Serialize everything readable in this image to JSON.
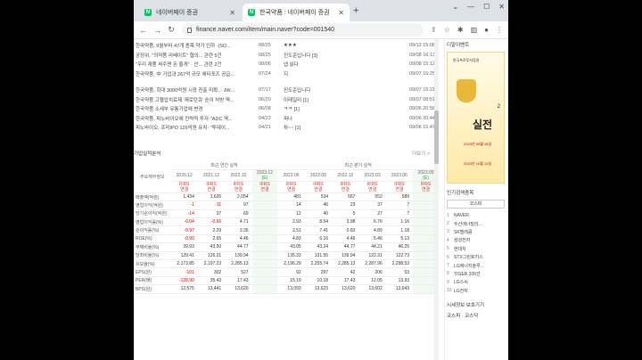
{
  "tabs": [
    {
      "label": "네이버페이 증권"
    },
    {
      "label": "한국약품 : 네이버페이 증권"
    }
  ],
  "address": {
    "url": "finance.naver.com/item/main.naver?code=001540"
  },
  "news": [
    {
      "title": "한국약품, 9월부터 47개 종목 약가 인하 ·(SO...",
      "date": "08/25",
      "comment": "★★★",
      "time": "09/12 15:08"
    },
    {
      "title": "공정위, \"의약품 리베이트\" 협의...  관련 5건",
      "date": "08/25",
      "comment": "진도준입니다 [3]",
      "time": "09/08 16:13"
    },
    {
      "title": "\"우리 제품 써주면 돈 줄게\" · 안...  관련 2건",
      "date": "08/06",
      "comment": "넵 읽다",
      "time": "09/08 15:12"
    },
    {
      "title": "한국약품, 中 기업과 267억 규모 에티포즈 공급...",
      "date": "07/24",
      "comment": "지",
      "time": "09/07 15:25"
    },
    {
      "title": "한국약품, 회대 3000억원 시장 진출 미확..· JW...",
      "date": "07/17",
      "comment": "진도준입니다",
      "time": "09/07 15:21"
    },
    {
      "title": "한국약품 고혈압치료제 '제로탄큐' 승이 처방 역...",
      "date": "06/20",
      "comment": "이레일리 [1]",
      "time": "09/07 08:51"
    },
    {
      "title": "한국약품 소세부 유통기업에 변경",
      "date": "06/08",
      "comment": "ㅋㅋ [1]",
      "time": "09/06 20:58"
    },
    {
      "title": "한국약품, 피노바이오에 전략적 투자·\"ADC 역...",
      "date": "04/22",
      "comment": "퍼나",
      "time": "09/06 20:44"
    },
    {
      "title": "피노바이오, 프리IPO 126억원 유치· \"투데이...",
      "date": "04/21",
      "comment": "차~~ [1]",
      "time": "09/06 15:47"
    }
  ],
  "section": {
    "title": "기업실적분석",
    "more": "더보기 >"
  },
  "table": {
    "group_annual": "최근 연간 실적",
    "group_quarter": "최근 분기 실적",
    "label_header": "주요재무정보",
    "periods": [
      "2020.12",
      "2021.12",
      "2022.12",
      "2023.12",
      "2022.06",
      "2022.09",
      "2022.12",
      "2023.03",
      "2023.06",
      "2023.09"
    ],
    "estimate_tag": "(E)",
    "ifrs_line1": "IFRS",
    "ifrs_line2": "연결",
    "rows": [
      {
        "label": "매출액(억원)",
        "values": [
          "1,434",
          "1,635",
          "2,054",
          "",
          "481",
          "534",
          "567",
          "552",
          "589",
          ""
        ]
      },
      {
        "label": "영업이익(억원)",
        "values": [
          "-1",
          "-11",
          "97",
          "",
          "14",
          "46",
          "23",
          "37",
          "7",
          ""
        ]
      },
      {
        "label": "당기순이익(억원)",
        "values": [
          "-14",
          "37",
          "69",
          "",
          "12",
          "40",
          "5",
          "27",
          "7",
          ""
        ]
      },
      {
        "label": "영업이익률(%)",
        "values": [
          "-0.04",
          "-0.66",
          "4.71",
          "",
          "2.93",
          "8.54",
          "3.98",
          "6.76",
          "1.16",
          ""
        ]
      },
      {
        "label": "순이익률(%)",
        "values": [
          "-0.97",
          "2.29",
          "3.35",
          "",
          "2.51",
          "7.41",
          "0.83",
          "4.89",
          "1.18",
          ""
        ]
      },
      {
        "label": "ROE(%)",
        "values": [
          "-0.90",
          "2.65",
          "4.46",
          "",
          "4.83",
          "6.16",
          "4.46",
          "5.46",
          "5.13",
          ""
        ]
      },
      {
        "label": "부채비율(%)",
        "values": [
          "39.93",
          "43.50",
          "44.77",
          "",
          "43.05",
          "43.24",
          "44.77",
          "44.21",
          "46.25",
          ""
        ]
      },
      {
        "label": "당좌비율(%)",
        "values": [
          "129.41",
          "126.21",
          "139.94",
          "",
          "135.33",
          "131.55",
          "139.94",
          "122.31",
          "122.73",
          ""
        ]
      },
      {
        "label": "유보율(%)",
        "values": [
          "2,173.85",
          "2,197.23",
          "2,285.13",
          "",
          "2,196.29",
          "2,255.74",
          "2,285.13",
          "2,287.96",
          "2,298.53",
          ""
        ]
      },
      {
        "label": "EPS(원)",
        "values": [
          "-101",
          "302",
          "527",
          "",
          "92",
          "297",
          "42",
          "206",
          "53",
          ""
        ]
      },
      {
        "label": "PER(배)",
        "values": [
          "-128.90",
          "35.43",
          "17.43",
          "",
          "15.19",
          "10.18",
          "17.43",
          "12.05",
          "13.93",
          ""
        ]
      },
      {
        "label": "BPS(원)",
        "values": [
          "12,575",
          "13,441",
          "13,620",
          "",
          "13,093",
          "13,623",
          "13,620",
          "13,602",
          "13,643",
          ""
        ]
      }
    ]
  },
  "side": {
    "title": "디알이벤트",
    "ad": {
      "brand": "한국프로투자증권",
      "big": "실전",
      "num": "2",
      "line1": "2023년 09월 18일",
      "line2": "2023년 10월 10일"
    },
    "popular_title": "인기검색종목",
    "popular_tab": "코스피",
    "popular": [
      {
        "rank": "1",
        "name": "NAVER"
      },
      {
        "rank": "2",
        "name": "두산에너빌리..."
      },
      {
        "rank": "3",
        "name": "SK텔레콤"
      },
      {
        "rank": "4",
        "name": "삼성전자"
      },
      {
        "rank": "5",
        "name": "현대차"
      },
      {
        "rank": "6",
        "name": "STX그린로지스"
      },
      {
        "rank": "7",
        "name": "LG에너지솔루..."
      },
      {
        "rank": "8",
        "name": "TIGER 200선"
      },
      {
        "rank": "9",
        "name": "LG스씨"
      },
      {
        "rank": "10",
        "name": "LG전자"
      }
    ],
    "footer": "시세정보 보호기기",
    "footer2": "코스피 · 코스닥"
  }
}
